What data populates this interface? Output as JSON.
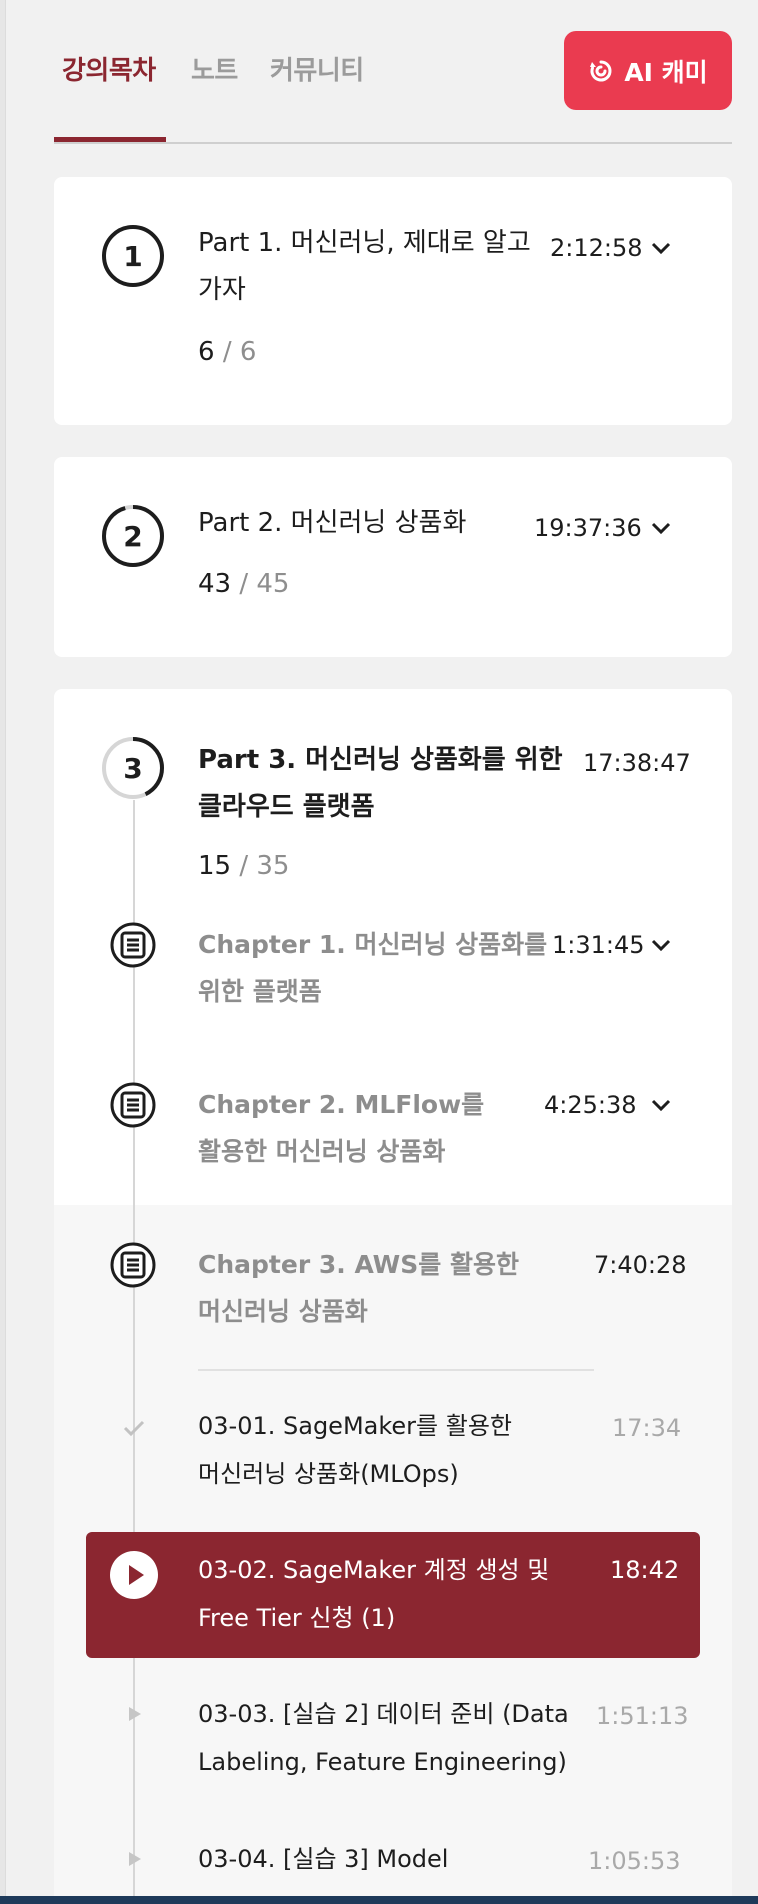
{
  "tabs": [
    {
      "label": "강의목차",
      "active": true
    },
    {
      "label": "노트",
      "active": false
    },
    {
      "label": "커뮤니티",
      "active": false
    }
  ],
  "ai_button": {
    "label": "AI 캐미",
    "icon": "ai-spiral-icon"
  },
  "parts": [
    {
      "number": "1",
      "title_line1": "Part 1. 머신러닝, 제대로 알고",
      "title_line2": "가자",
      "time": "2:12:58",
      "done": "6",
      "sep": "/",
      "total": "6"
    },
    {
      "number": "2",
      "title_line1": "Part 2. 머신러닝 상품화",
      "time": "19:37:36",
      "done": "43",
      "sep": "/",
      "total": "45"
    },
    {
      "number": "3",
      "title_line1": "Part 3. 머신러닝 상품화를 위한",
      "title_line2": "클라우드 플랫폼",
      "time": "17:38:47",
      "done": "15",
      "sep": "/",
      "total": "35"
    }
  ],
  "chapters": [
    {
      "prefix": "Chapter 1.",
      "line1": " 머신러닝 상품화를",
      "line2": "위한 플랫폼",
      "time": "1:31:45"
    },
    {
      "prefix": "Chapter 2.",
      "line1": " MLFlow를",
      "line2": "활용한 머신러닝 상품화",
      "time": "4:25:38"
    },
    {
      "prefix": "Chapter 3.",
      "line1": " AWS를 활용한",
      "line2": "머신러닝 상품화",
      "time": "7:40:28"
    }
  ],
  "lessons": [
    {
      "line1": "03-01. SageMaker를 활용한",
      "line2": "머신러닝 상품화(MLOps)",
      "time": "17:34",
      "status": "completed"
    },
    {
      "line1": "03-02. SageMaker 계정 생성 및",
      "line2": "Free Tier 신청 (1)",
      "time": "18:42",
      "status": "playing"
    },
    {
      "line1": "03-03. [실습 2] 데이터 준비 (Data",
      "line2": "Labeling, Feature Engineering)",
      "time": "1:51:13",
      "status": "pending"
    },
    {
      "line1": "03-04. [실습 3] Model",
      "time": "1:05:53",
      "status": "pending"
    }
  ],
  "colors": {
    "accent": "#8b2630",
    "ai_button": "#ea3b50",
    "muted": "#8e8e8e"
  }
}
